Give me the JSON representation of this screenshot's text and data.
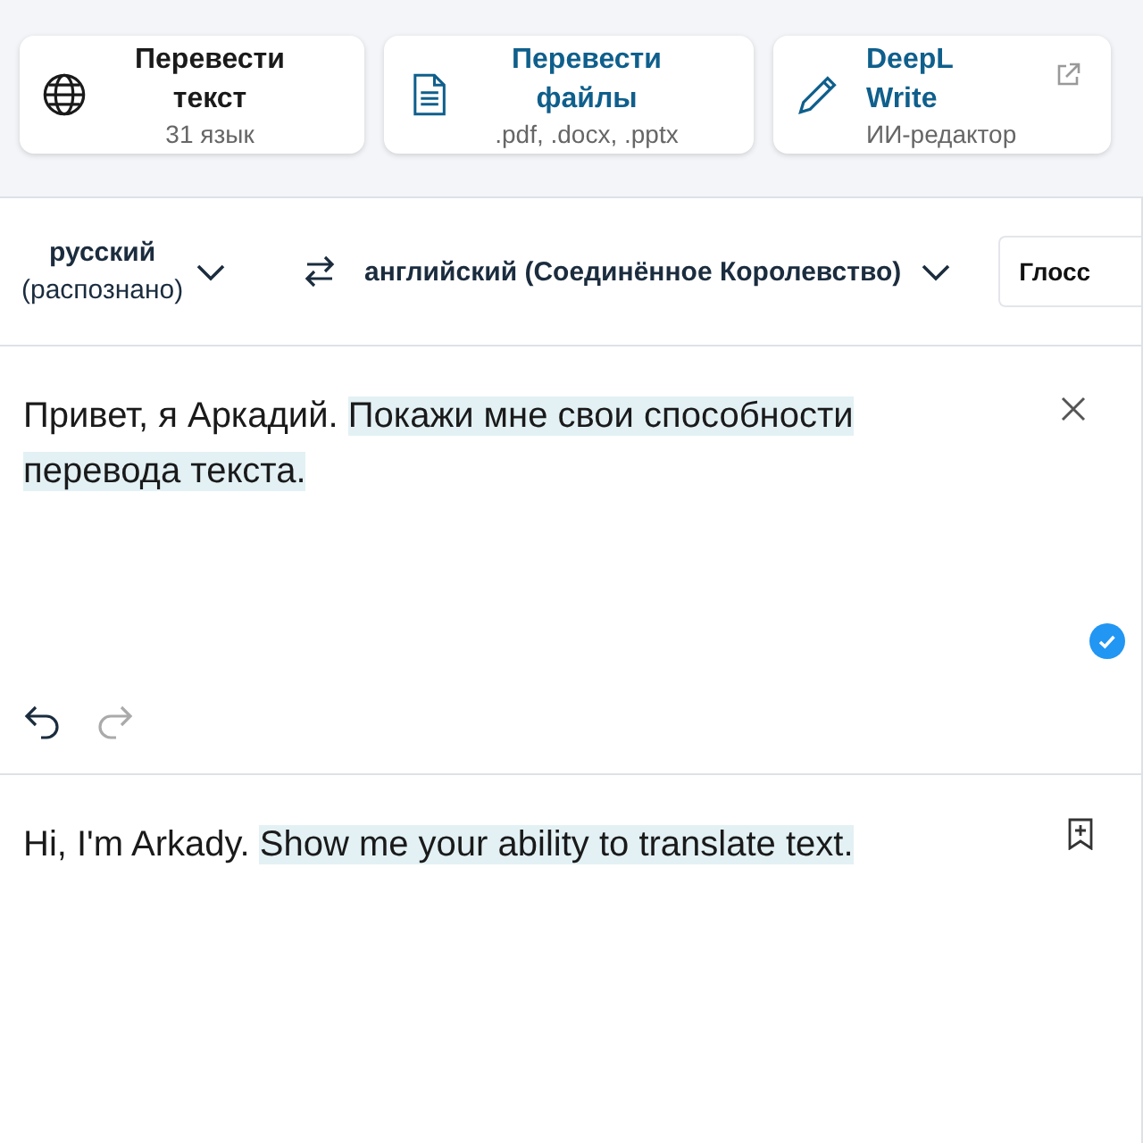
{
  "mode_tabs": [
    {
      "title": "Перевести текст",
      "subtitle": "31 язык",
      "selected": true,
      "external": false
    },
    {
      "title": "Перевести файлы",
      "subtitle": ".pdf, .docx, .pptx",
      "selected": false,
      "external": false
    },
    {
      "title": "DeepL Write",
      "subtitle": "ИИ-редактор",
      "selected": false,
      "external": true
    }
  ],
  "language_bar": {
    "source_language": "русский",
    "source_note": "(распознано)",
    "target_language": "английский (Соединённое Королевство)",
    "glossary_button": "Глосс"
  },
  "source": {
    "segments": [
      {
        "text": "Привет, я Аркадий.",
        "highlighted": false
      },
      {
        "text": "Покажи мне свои способности",
        "highlighted": true
      },
      {
        "text": "перевода текста.",
        "highlighted": true
      }
    ],
    "checked": true,
    "undo_disabled": false,
    "redo_disabled": true
  },
  "target": {
    "segments": [
      {
        "text": "Hi, I'm Arkady.",
        "highlighted": false
      },
      {
        "text": "Show me your ability to translate text.",
        "highlighted": true
      }
    ]
  }
}
